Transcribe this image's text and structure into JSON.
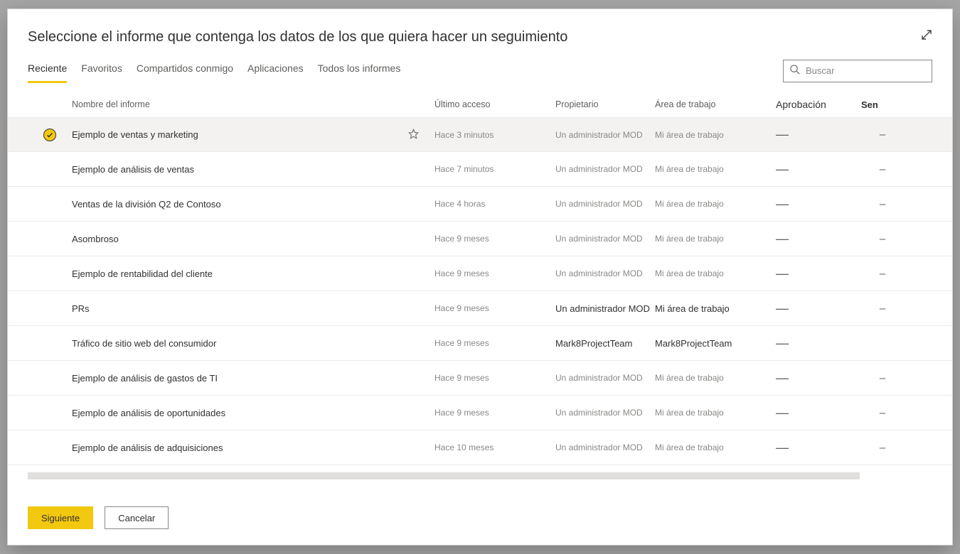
{
  "dialog": {
    "title": "Seleccione el informe que contenga los datos de los que quiera hacer un seguimiento"
  },
  "tabs": {
    "items": [
      {
        "label": "Reciente",
        "active": true
      },
      {
        "label": "Favoritos",
        "active": false
      },
      {
        "label": "Compartidos conmigo",
        "active": false
      },
      {
        "label": "Aplicaciones",
        "active": false
      },
      {
        "label": "Todos los informes",
        "active": false
      }
    ]
  },
  "search": {
    "placeholder": "Buscar"
  },
  "columns": {
    "name": "Nombre del informe",
    "last_access": "Último acceso",
    "owner": "Propietario",
    "workspace": "Área de trabajo",
    "approval": "Aprobación",
    "sensitivity": "Sen"
  },
  "rows": [
    {
      "selected": true,
      "name": "Ejemplo de ventas y marketing",
      "last_access": "Hace 3 minutos",
      "owner": "Un administrador MOD",
      "workspace": "Mi área de trabajo",
      "approval": "—",
      "sensitivity": "–",
      "show_star": true,
      "owner_bold": false
    },
    {
      "selected": false,
      "name": "Ejemplo de análisis de ventas",
      "last_access": "Hace 7 minutos",
      "owner": "Un administrador MOD",
      "workspace": "Mi área de trabajo",
      "approval": "—",
      "sensitivity": "–",
      "show_star": false,
      "owner_bold": false
    },
    {
      "selected": false,
      "name": "Ventas de la división Q2 de Contoso",
      "last_access": "Hace 4 horas",
      "owner": "Un administrador MOD",
      "workspace": "Mi área de trabajo",
      "approval": "—",
      "sensitivity": "–",
      "show_star": false,
      "owner_bold": false
    },
    {
      "selected": false,
      "name": "Asombroso",
      "last_access": "Hace 9 meses",
      "owner": "Un administrador MOD",
      "workspace": "Mi área de trabajo",
      "approval": "—",
      "sensitivity": "–",
      "show_star": false,
      "owner_bold": false
    },
    {
      "selected": false,
      "name": "Ejemplo de rentabilidad del cliente",
      "last_access": "Hace 9 meses",
      "owner": "Un administrador MOD",
      "workspace": "Mi área de trabajo",
      "approval": "—",
      "sensitivity": "–",
      "show_star": false,
      "owner_bold": false
    },
    {
      "selected": false,
      "name": "PRs",
      "last_access": "Hace 9 meses",
      "owner": "Un administrador MOD",
      "workspace": "Mi área de trabajo",
      "approval": "—",
      "sensitivity": "–",
      "show_star": false,
      "owner_bold": true
    },
    {
      "selected": false,
      "name": "Tráfico de sitio web del consumidor",
      "last_access": "Hace 9 meses",
      "owner": "Mark8ProjectTeam",
      "workspace": "Mark8ProjectTeam",
      "approval": "—",
      "sensitivity": "",
      "show_star": false,
      "owner_bold": true
    },
    {
      "selected": false,
      "name": "Ejemplo de análisis de gastos de TI",
      "last_access": "Hace 9 meses",
      "owner": "Un administrador MOD",
      "workspace": "Mi área de trabajo",
      "approval": "—",
      "sensitivity": "–",
      "show_star": false,
      "owner_bold": false
    },
    {
      "selected": false,
      "name": "Ejemplo de análisis de oportunidades",
      "last_access": "Hace 9 meses",
      "owner": "Un administrador MOD",
      "workspace": "Mi área de trabajo",
      "approval": "—",
      "sensitivity": "–",
      "show_star": false,
      "owner_bold": false
    },
    {
      "selected": false,
      "name": "Ejemplo de análisis de adquisiciones",
      "last_access": "Hace 10 meses",
      "owner": "Un administrador MOD",
      "workspace": "Mi área de trabajo",
      "approval": "—",
      "sensitivity": "–",
      "show_star": false,
      "owner_bold": false
    }
  ],
  "footer": {
    "next": "Siguiente",
    "cancel": "Cancelar"
  }
}
